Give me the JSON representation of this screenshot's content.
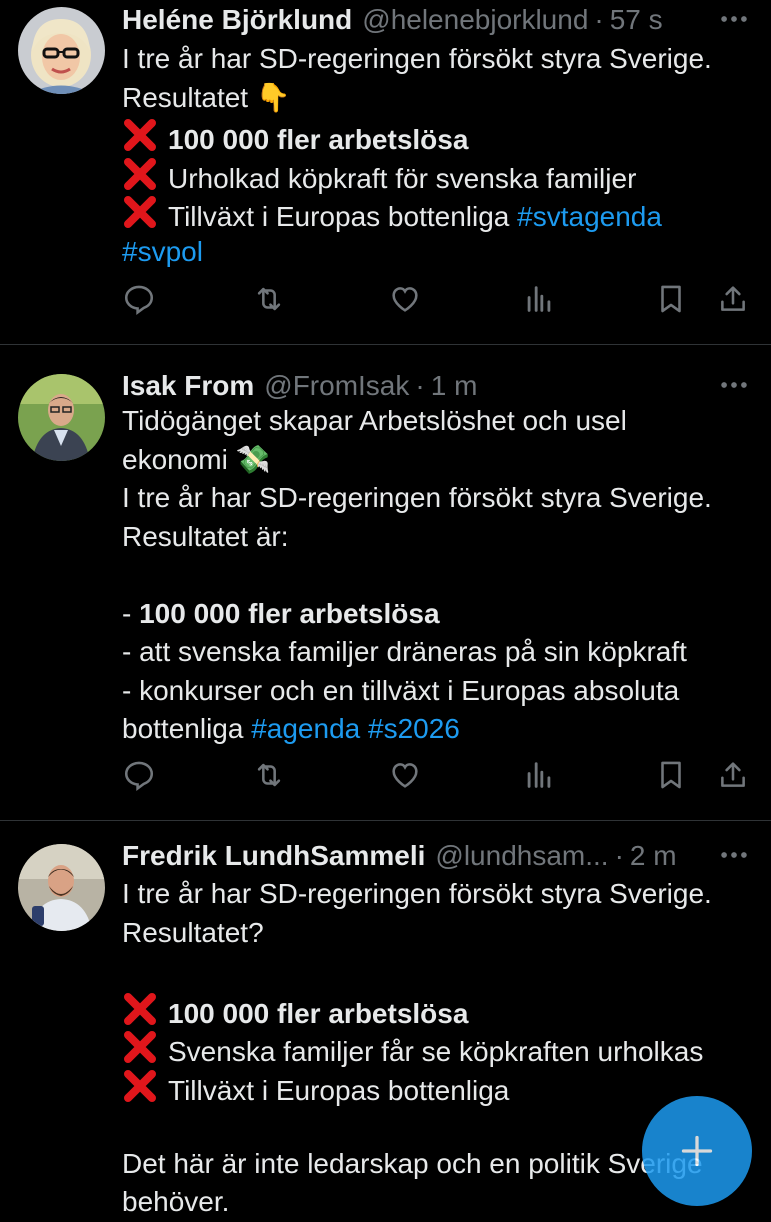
{
  "tweets": [
    {
      "name": "Heléne Björklund",
      "handle": "@helenebjorklund",
      "time": "57 s",
      "lines": [
        {
          "text": "I tre år har SD-regeringen försökt styra Sverige."
        },
        {
          "text": "Resultatet 👇"
        },
        {
          "text": "100 000 fler arbetslösa"
        },
        {
          "text": "Urholkad köpkraft för svenska familjer"
        },
        {
          "text": "Tillväxt i Europas bottenliga ",
          "tag": "#svtagenda"
        },
        {
          "tag": "#svpol"
        }
      ]
    },
    {
      "name": "Isak From",
      "handle": "@FromIsak",
      "time": "1 m",
      "lines": [
        {
          "text": "Tidögänget skapar Arbetslöshet och usel"
        },
        {
          "text": "ekonomi 💸"
        },
        {
          "text": "I tre år har SD-regeringen försökt styra Sverige."
        },
        {
          "text": "Resultatet är:"
        },
        {
          "prefix": "- ",
          "text": "100 000 fler arbetslösa"
        },
        {
          "text": "- att svenska familjer dräneras på sin köpkraft"
        },
        {
          "text": "- konkurser och en tillväxt i Europas absoluta"
        },
        {
          "text": "bottenliga ",
          "tag": "#agenda",
          "tag2": " #s2026"
        }
      ]
    },
    {
      "name": "Fredrik LundhSammeli",
      "handle": "@lundhsam...",
      "time": "2 m",
      "lines": [
        {
          "text": "I tre år har SD-regeringen försökt styra Sverige."
        },
        {
          "text": "Resultatet?"
        },
        {
          "text": "100 000 fler arbetslösa"
        },
        {
          "text": "Svenska familjer får se köpkraften urholkas"
        },
        {
          "text": "Tillväxt i Europas bottenliga"
        },
        {
          "text": "Det här är inte ledarskap och en politik Sverige"
        },
        {
          "text": "behöver."
        }
      ]
    }
  ],
  "colors": {
    "background": "#000000",
    "text": "#e7e9ea",
    "muted": "#71767b",
    "link": "#1d9bf0",
    "red_x": "#e0161b",
    "divider": "#2f3336"
  },
  "icons": [
    "reply-icon",
    "retweet-icon",
    "like-icon",
    "views-icon",
    "bookmark-icon",
    "share-icon",
    "more-icon",
    "compose-icon",
    "red-x-icon"
  ]
}
